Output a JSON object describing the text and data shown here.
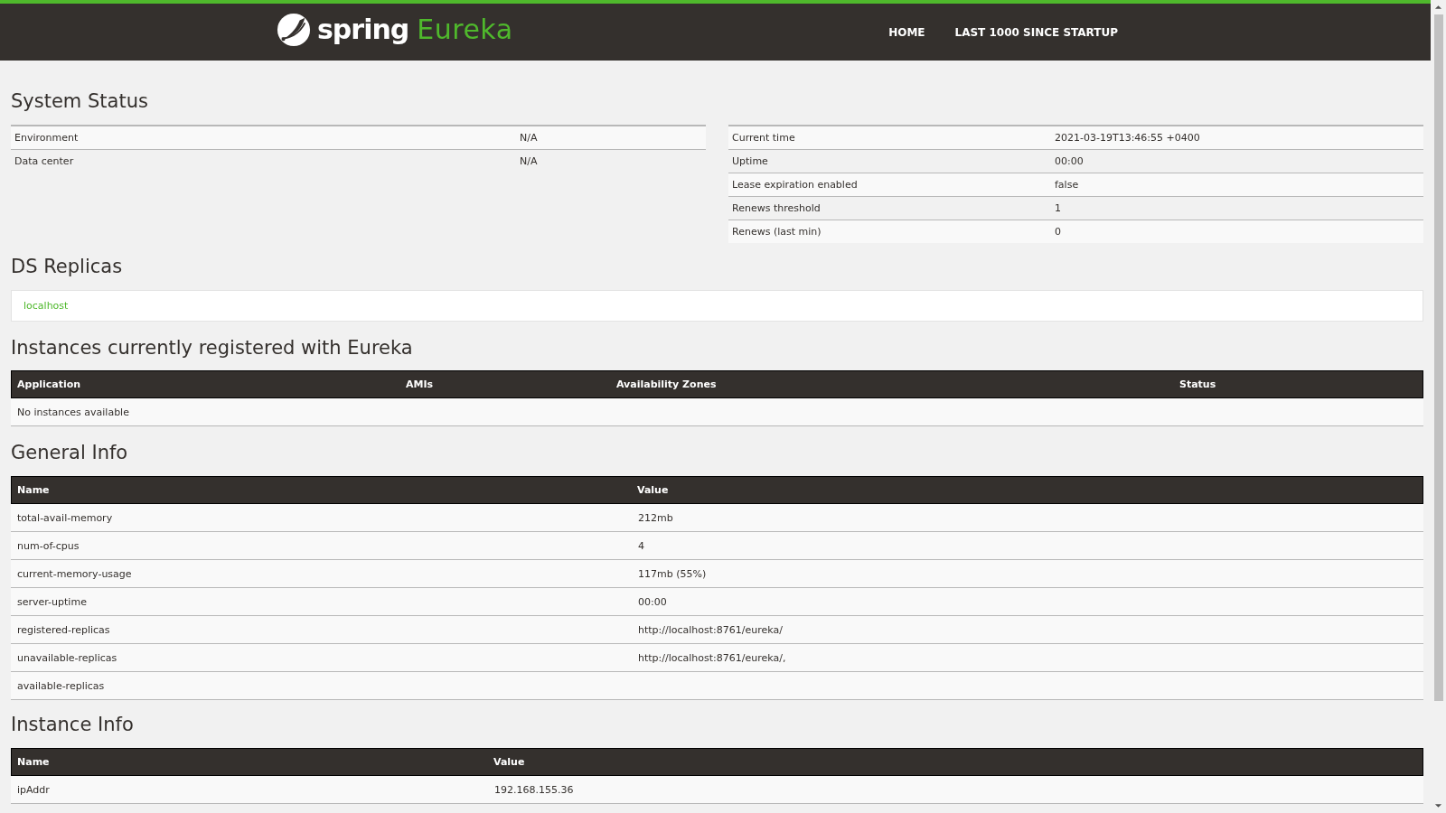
{
  "header": {
    "brand": "spring",
    "product": "Eureka",
    "nav": [
      {
        "label": "HOME"
      },
      {
        "label": "LAST 1000 SINCE STARTUP"
      }
    ]
  },
  "system_status": {
    "title": "System Status",
    "left": [
      {
        "name": "Environment",
        "value": "N/A"
      },
      {
        "name": "Data center",
        "value": "N/A"
      }
    ],
    "right": [
      {
        "name": "Current time",
        "value": "2021-03-19T13:46:55 +0400"
      },
      {
        "name": "Uptime",
        "value": "00:00"
      },
      {
        "name": "Lease expiration enabled",
        "value": "false"
      },
      {
        "name": "Renews threshold",
        "value": "1"
      },
      {
        "name": "Renews (last min)",
        "value": "0"
      }
    ]
  },
  "ds_replicas": {
    "title": "DS Replicas",
    "items": [
      "localhost"
    ]
  },
  "instances": {
    "title": "Instances currently registered with Eureka",
    "columns": [
      "Application",
      "AMIs",
      "Availability Zones",
      "Status"
    ],
    "empty_message": "No instances available"
  },
  "general_info": {
    "title": "General Info",
    "columns": [
      "Name",
      "Value"
    ],
    "rows": [
      {
        "name": "total-avail-memory",
        "value": "212mb"
      },
      {
        "name": "num-of-cpus",
        "value": "4"
      },
      {
        "name": "current-memory-usage",
        "value": "117mb (55%)"
      },
      {
        "name": "server-uptime",
        "value": "00:00"
      },
      {
        "name": "registered-replicas",
        "value": "http://localhost:8761/eureka/"
      },
      {
        "name": "unavailable-replicas",
        "value": "http://localhost:8761/eureka/,"
      },
      {
        "name": "available-replicas",
        "value": ""
      }
    ]
  },
  "instance_info": {
    "title": "Instance Info",
    "columns": [
      "Name",
      "Value"
    ],
    "rows": [
      {
        "name": "ipAddr",
        "value": "192.168.155.36"
      }
    ]
  }
}
